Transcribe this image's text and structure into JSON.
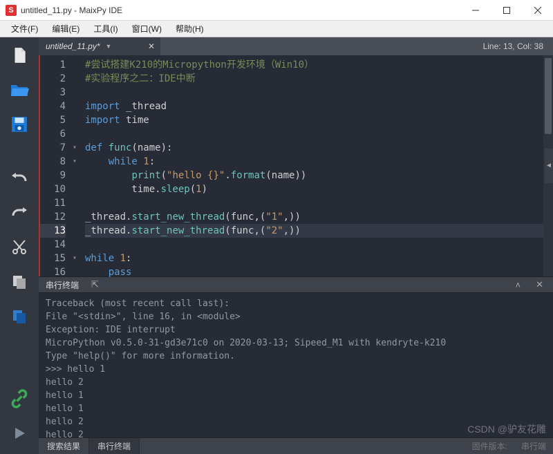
{
  "window": {
    "title": "untitled_11.py - MaixPy IDE",
    "app_icon_letter": "S"
  },
  "menu": {
    "file": "文件(F)",
    "edit": "编辑(E)",
    "tools": "工具(I)",
    "window": "窗口(W)",
    "help": "帮助(H)"
  },
  "tabs": {
    "file_name": "untitled_11.py*",
    "status": "Line: 13, Col: 38"
  },
  "editor": {
    "lines": [
      {
        "n": 1,
        "fold": "",
        "html": "<span class='tok-comment'>#尝试搭建K210的Micropython开发环境（Win10）</span>"
      },
      {
        "n": 2,
        "fold": "",
        "html": "<span class='tok-comment'>#实验程序之二：IDE中断</span>"
      },
      {
        "n": 3,
        "fold": "",
        "html": ""
      },
      {
        "n": 4,
        "fold": "",
        "html": "<span class='tok-kw'>import</span> <span class='tok-id'>_thread</span>"
      },
      {
        "n": 5,
        "fold": "",
        "html": "<span class='tok-kw'>import</span> <span class='tok-id'>time</span>"
      },
      {
        "n": 6,
        "fold": "",
        "html": ""
      },
      {
        "n": 7,
        "fold": "v",
        "html": "<span class='tok-kw'>def</span> <span class='tok-fn'>func</span>(name):"
      },
      {
        "n": 8,
        "fold": "v",
        "html": "    <span class='tok-kw'>while</span> <span class='tok-num'>1</span>:"
      },
      {
        "n": 9,
        "fold": "",
        "html": "        <span class='tok-fn'>print</span>(<span class='tok-str'>\"hello {}\"</span>.<span class='tok-fn'>format</span>(name))"
      },
      {
        "n": 10,
        "fold": "",
        "html": "        time.<span class='tok-fn'>sleep</span>(<span class='tok-num'>1</span>)"
      },
      {
        "n": 11,
        "fold": "",
        "html": ""
      },
      {
        "n": 12,
        "fold": "",
        "html": "_thread.<span class='tok-fn'>start_new_thread</span>(func,(<span class='tok-str'>\"1\"</span>,))"
      },
      {
        "n": 13,
        "fold": "",
        "html": "_thread.<span class='tok-fn'>start_new_thread</span>(func,(<span class='tok-str'>\"2\"</span>,))",
        "current": true
      },
      {
        "n": 14,
        "fold": "",
        "html": ""
      },
      {
        "n": 15,
        "fold": "v",
        "html": "<span class='tok-kw'>while</span> <span class='tok-num'>1</span>:"
      },
      {
        "n": 16,
        "fold": "",
        "html": "    <span class='tok-kw'>pass</span>"
      }
    ]
  },
  "terminal_header": {
    "label": "串行终端",
    "pin_icon": "📌"
  },
  "terminal": {
    "lines": [
      "Traceback (most recent call last):",
      "  File \"<stdin>\", line 16, in <module>",
      "Exception: IDE interrupt",
      "MicroPython v0.5.0-31-gd3e71c0 on 2020-03-13; Sipeed_M1 with kendryte-k210",
      "Type \"help()\" for more information.",
      ">>> hello 1",
      "hello 2",
      "hello 1",
      "hello 1",
      "hello 2",
      "hello 2"
    ]
  },
  "bottom_tabs": {
    "search": "搜索结果",
    "serial": "串行终端",
    "fw": "固件版本:",
    "serial_label": "串行端"
  },
  "watermark": "CSDN @驴友花雕",
  "icons": {
    "new": "new-file-icon",
    "open": "open-folder-icon",
    "save": "save-icon",
    "undo": "undo-icon",
    "redo": "redo-icon",
    "cut": "cut-icon",
    "copy": "copy-icon",
    "paste": "paste-icon",
    "connect": "link-icon",
    "run": "play-icon"
  }
}
